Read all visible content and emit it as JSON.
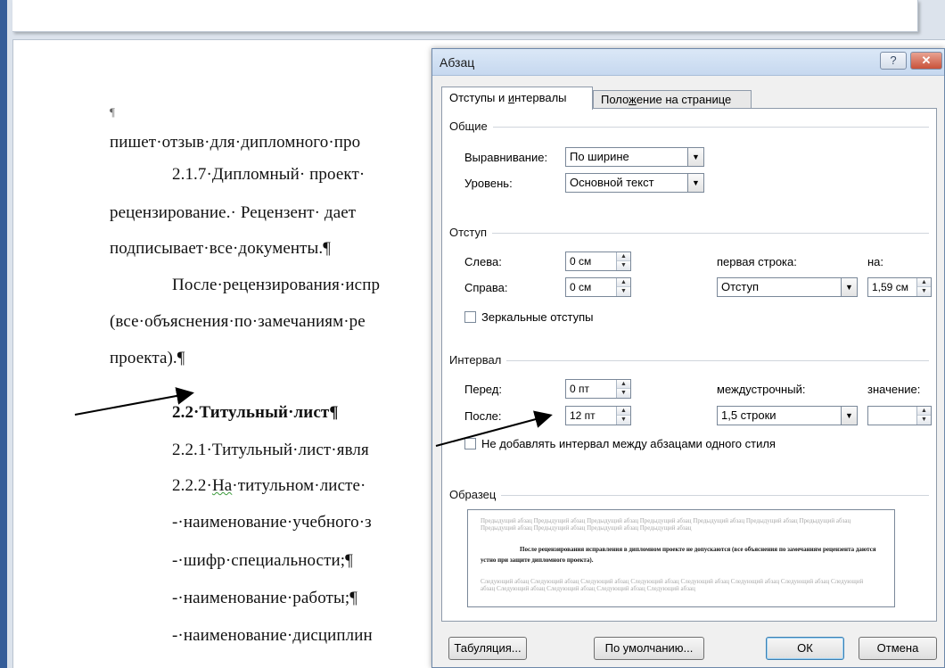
{
  "document": {
    "lines": [
      {
        "text": "¶",
        "style": "small",
        "x": 0
      },
      {
        "text": "пишет·отзыв·для·дипломного·про",
        "style": "normal"
      },
      {
        "text": "2.1.7·Дипломный· проект·",
        "style": "normal"
      },
      {
        "text": "рецензирование.· Рецензент· дает",
        "style": "normal"
      },
      {
        "text": "подписывает·все·документы.¶",
        "style": "normal"
      },
      {
        "text": "После·рецензирования·испр",
        "style": "normal"
      },
      {
        "text": "(все·объяснения·по·замечаниям·ре",
        "style": "normal"
      },
      {
        "text": "проекта).¶",
        "style": "normal"
      },
      {
        "text": "2.2·Титульный·лист¶",
        "style": "bold"
      },
      {
        "text": "2.2.1·Титульный·лист·явля",
        "style": "normal"
      },
      {
        "text_a": "2.2.2·",
        "text_b": "На",
        "text_c": "·титульном·листе·",
        "style": "squiggle"
      },
      {
        "text": "-·наименование·учебного·з",
        "style": "normal"
      },
      {
        "text": "-·шифр·специальности;¶",
        "style": "normal"
      },
      {
        "text": "-·наименование·работы;¶",
        "style": "normal"
      },
      {
        "text": "-·наименование·дисциплин",
        "style": "normal"
      }
    ]
  },
  "dialog": {
    "title": "Абзац",
    "help": "?",
    "close": "✕",
    "tabs": [
      {
        "pre": "Отступы и ",
        "u": "и",
        "post": "нтервалы",
        "full": "Отступы и интервалы"
      },
      {
        "pre": "Поло",
        "u": "ж",
        "post": "ение на странице",
        "full": "Положение на странице"
      }
    ],
    "general": {
      "title": "Общие",
      "alignment_label": "Выравнивание:",
      "alignment_value": "По ширине",
      "level_label": "Уровень:",
      "level_value": "Основной текст"
    },
    "indent": {
      "title": "Отступ",
      "left_label": "Слева:",
      "left_value": "0 см",
      "right_label": "Справа:",
      "right_value": "0 см",
      "first_line_label": "первая строка:",
      "first_line_value": "Отступ",
      "by_label": "на:",
      "by_value": "1,59 см",
      "mirror_label": "Зеркальные отступы",
      "mirror_checked": false
    },
    "spacing": {
      "title": "Интервал",
      "before_label": "Перед:",
      "before_value": "0 пт",
      "after_label": "После:",
      "after_value": "12 пт",
      "line_label": "междустрочный:",
      "line_value": "1,5 строки",
      "value_label": "значение:",
      "value_value": "",
      "dont_add_label": "Не добавлять интервал между абзацами одного стиля",
      "dont_add_checked": false
    },
    "preview": {
      "title": "Образец",
      "prev_text": "Предыдущий абзац Предыдущий абзац Предыдущий абзац Предыдущий абзац Предыдущий абзац Предыдущий абзац Предыдущий абзац Предыдущий абзац Предыдущий абзац Предыдущий абзац Предыдущий абзац",
      "main_text": "После рецензирования исправления в дипломном проекте не допускаются (все объяснения по замечаниям рецензента даются устно при защите дипломного проекта).",
      "next_text": "Следующий абзац Следующий абзац Следующий абзац Следующий абзац Следующий абзац Следующий абзац Следующий абзац Следующий абзац Следующий абзац Следующий абзац Следующий абзац Следующий абзац"
    },
    "buttons": {
      "tabs": "Табуляция...",
      "default": "По умолчанию...",
      "ok": "ОК",
      "cancel": "Отмена"
    }
  }
}
